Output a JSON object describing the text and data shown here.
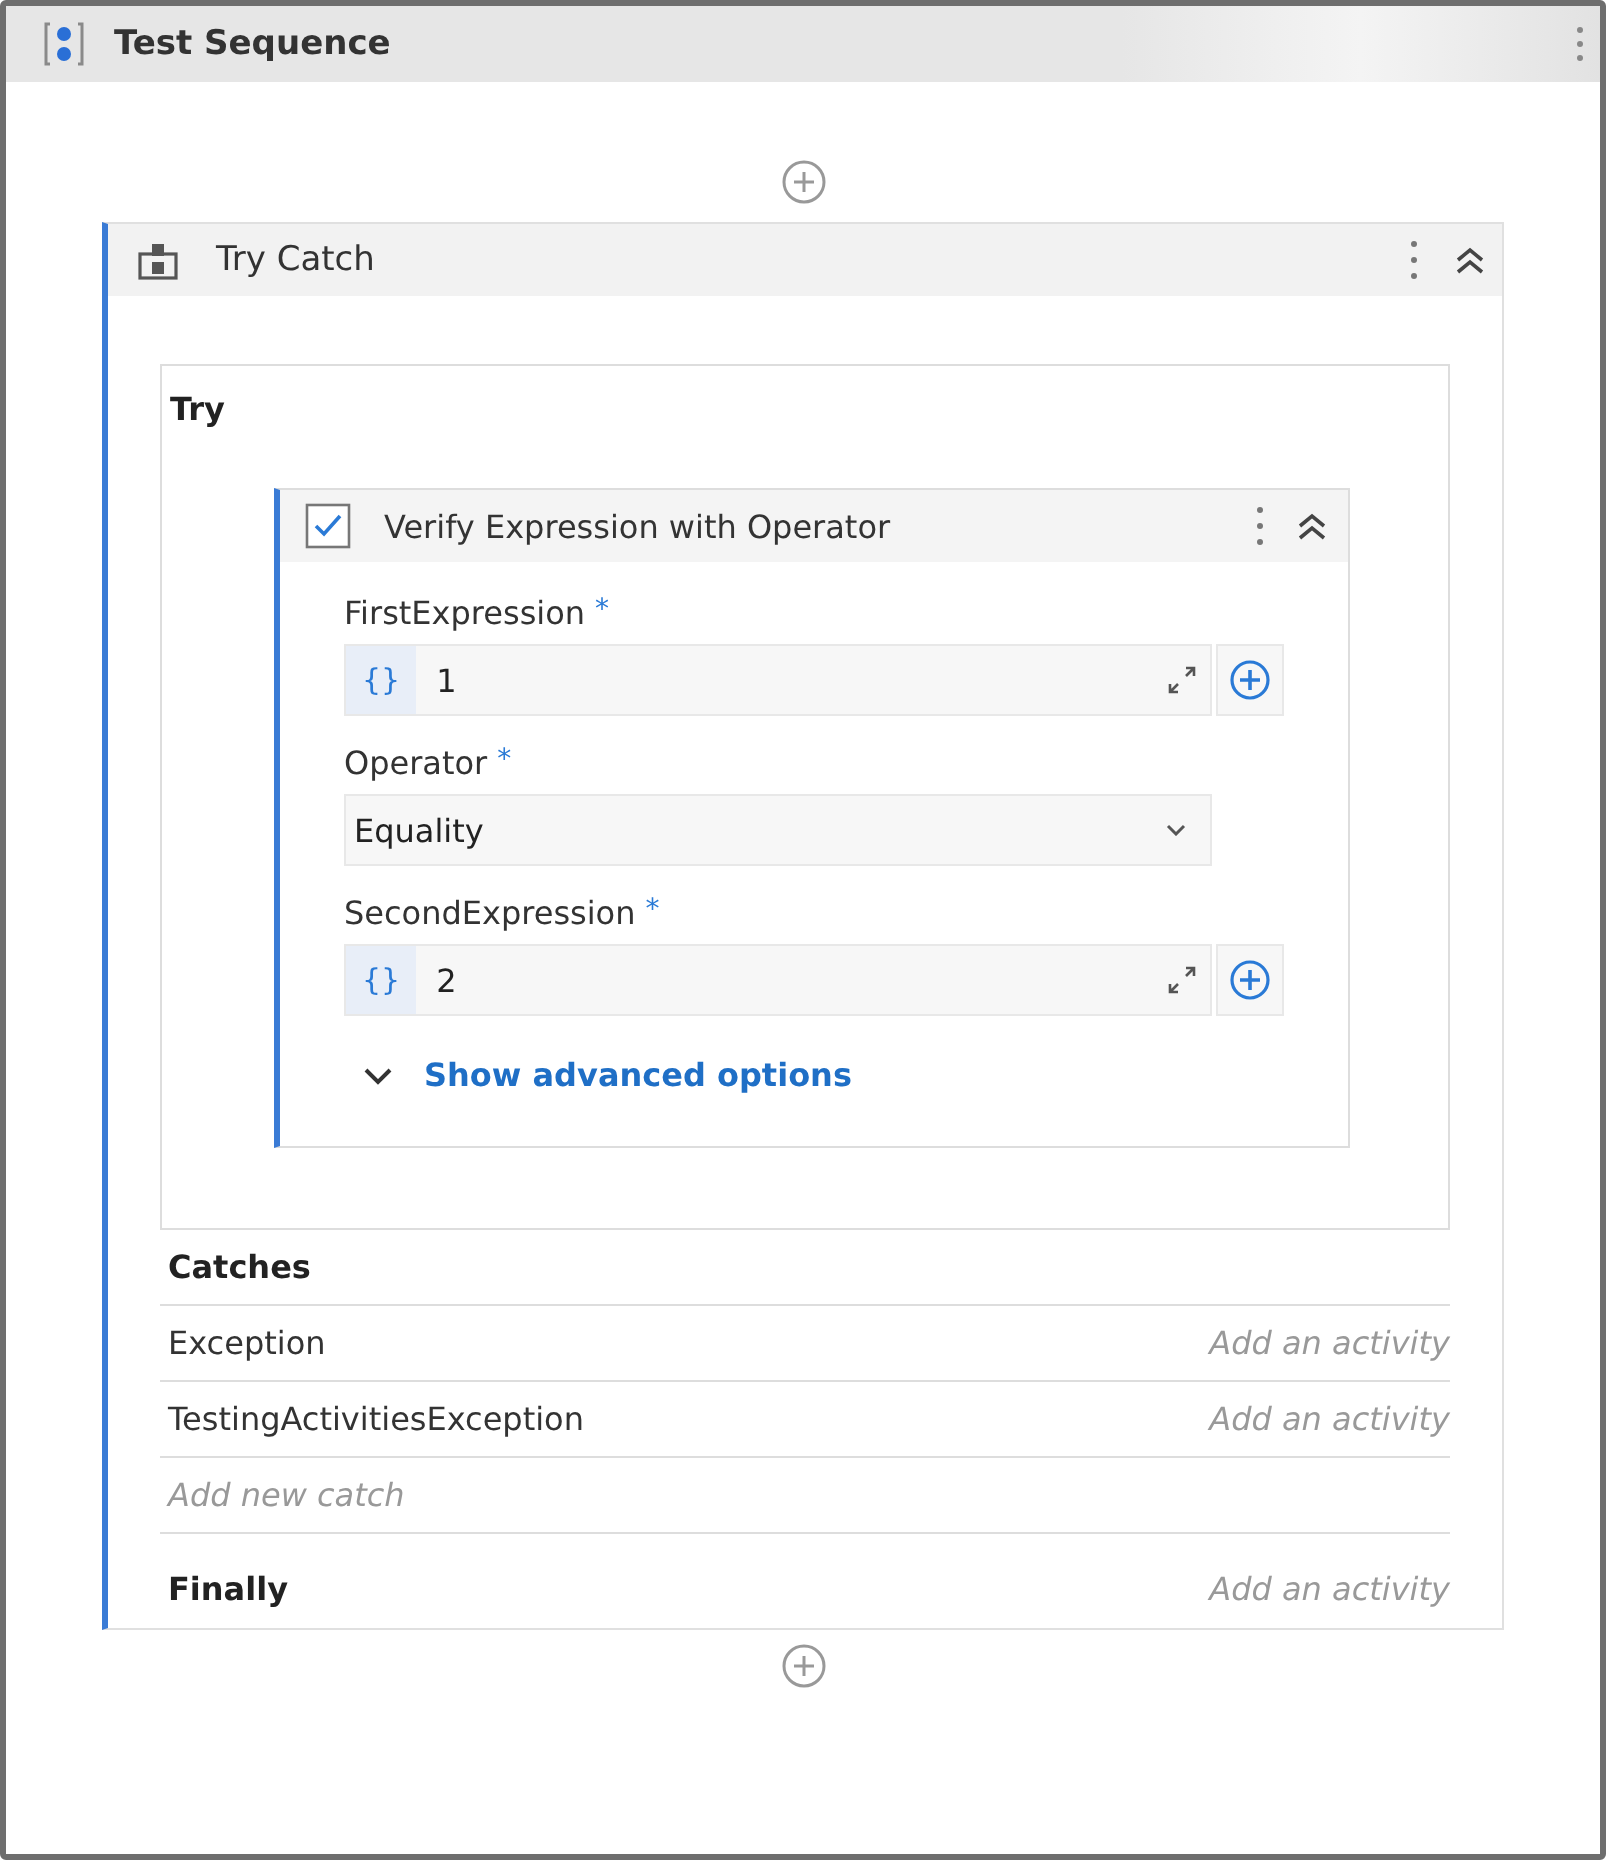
{
  "sequence": {
    "title": "Test Sequence"
  },
  "try_catch": {
    "title": "Try Catch",
    "try_label": "Try",
    "activity": {
      "title": "Verify Expression with Operator",
      "fields": [
        {
          "kind": "expression",
          "label": "FirstExpression",
          "required_mark": "*",
          "prefix": "{}",
          "value": "1"
        },
        {
          "kind": "dropdown",
          "label": "Operator",
          "required_mark": "*",
          "value": "Equality"
        },
        {
          "kind": "expression",
          "label": "SecondExpression",
          "required_mark": "*",
          "prefix": "{}",
          "value": "2"
        }
      ],
      "advanced_link": "Show advanced options"
    },
    "catches_label": "Catches",
    "catches": [
      {
        "exception": "Exception",
        "placeholder": "Add an activity"
      },
      {
        "exception": "TestingActivitiesException",
        "placeholder": "Add an activity"
      }
    ],
    "add_catch": "Add new catch",
    "finally": {
      "label": "Finally",
      "placeholder": "Add an activity"
    }
  }
}
